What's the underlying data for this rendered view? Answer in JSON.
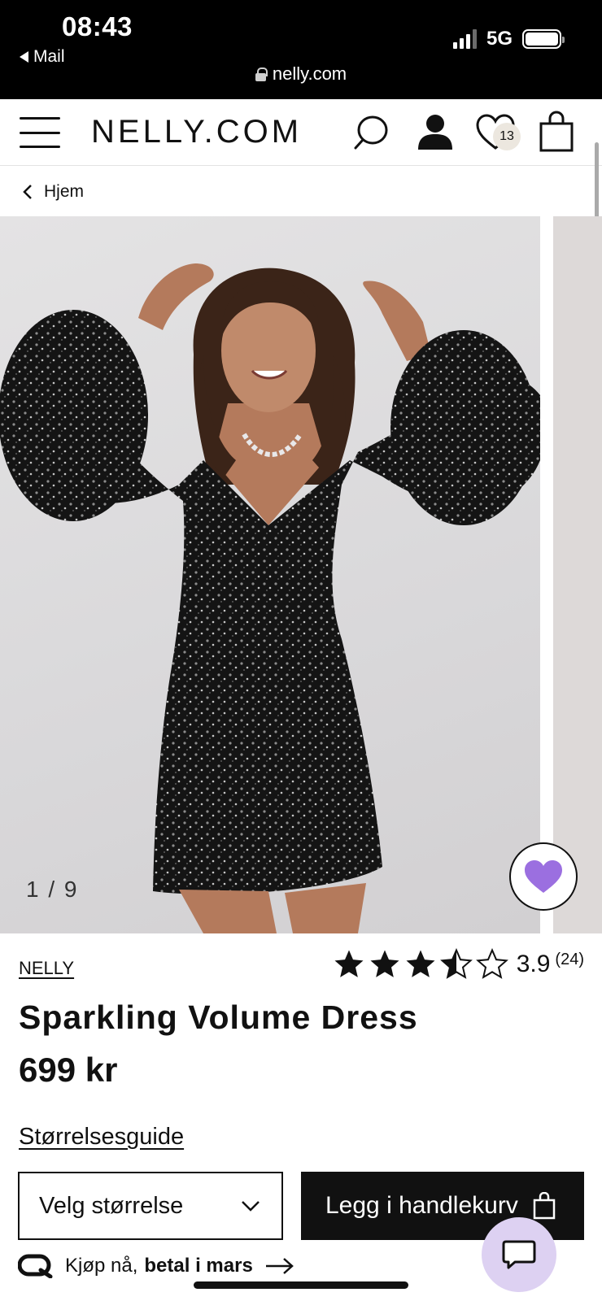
{
  "status_bar": {
    "time": "08:43",
    "back_app": "Mail",
    "network": "5G",
    "url": "nelly.com",
    "icons": [
      "signal-icon",
      "battery-icon",
      "lock-icon"
    ]
  },
  "header": {
    "logo": "NELLY.COM",
    "wishlist_count": "13",
    "icons": [
      "hamburger-menu-icon",
      "search-icon",
      "account-icon",
      "wishlist-heart-icon",
      "shopping-bag-icon"
    ]
  },
  "breadcrumb": {
    "label": "Hjem"
  },
  "gallery": {
    "counter": "1 / 9",
    "current": 1,
    "total": 9
  },
  "product": {
    "brand": "NELLY",
    "name": "Sparkling Volume Dress",
    "price": "699 kr",
    "rating": {
      "value": "3.9",
      "count": "(24)",
      "stars": 3.5,
      "max": 5
    }
  },
  "actions": {
    "size_guide": "Størrelsesguide",
    "size_select": "Velg størrelse",
    "add_to_cart": "Legg i handlekurv"
  },
  "pay_later": {
    "prefix": "Kjøp nå,",
    "emphasis": "betal i mars"
  },
  "colors": {
    "accent_purple": "#9b6fe0",
    "chat_bg": "#ddd1f2",
    "button_black": "#111111"
  }
}
